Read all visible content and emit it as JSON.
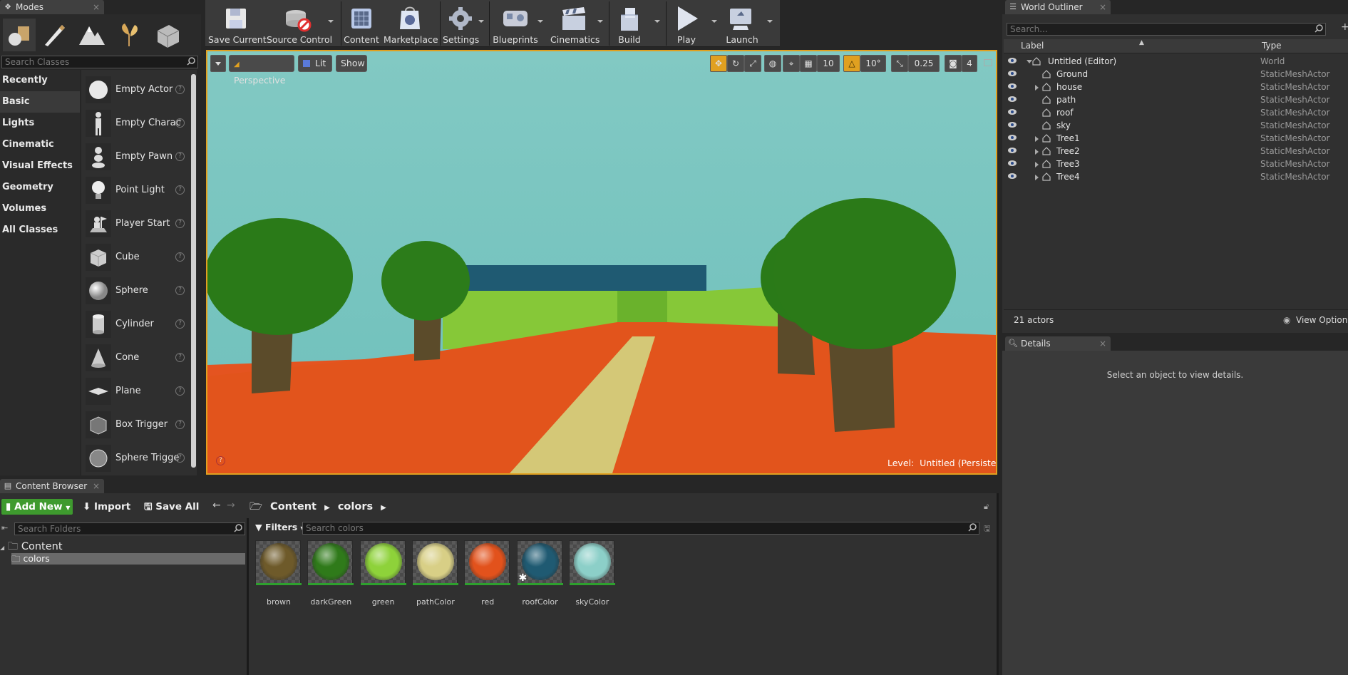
{
  "colors": {
    "accent": "#e0a020",
    "add_green": "#3e9a2e",
    "sky": "#7ec7c2",
    "ground": "#e55a1e",
    "tree_green": "#2b7a18",
    "trunk": "#5a4a28",
    "path": "#d6c97a",
    "roof": "#1e5a72",
    "wall_green": "#8cc838"
  },
  "modes": {
    "tab_title": "Modes",
    "mode_icons": [
      "place-mode-icon",
      "paint-mode-icon",
      "landscape-mode-icon",
      "foliage-mode-icon",
      "geometry-mode-icon"
    ],
    "search_placeholder": "Search Classes",
    "categories": [
      "Recently Placed",
      "Basic",
      "Lights",
      "Cinematic",
      "Visual Effects",
      "Geometry",
      "Volumes",
      "All Classes"
    ],
    "items": [
      "Empty Actor",
      "Empty Charac",
      "Empty Pawn",
      "Point Light",
      "Player Start",
      "Cube",
      "Sphere",
      "Cylinder",
      "Cone",
      "Plane",
      "Box Trigger",
      "Sphere Trigge"
    ]
  },
  "toolbar": {
    "buttons": [
      "Save Current",
      "Source Control",
      "Content",
      "Marketplace",
      "Settings",
      "Blueprints",
      "Cinematics",
      "Build",
      "Play",
      "Launch"
    ]
  },
  "viewport": {
    "perspective": "Perspective",
    "lit": "Lit",
    "show": "Show",
    "grid_snap": "10",
    "rot_snap": "10°",
    "scale_snap": "0.25",
    "camera_speed": "4",
    "level_label": "Level:",
    "level_name": "Untitled (Persistent)"
  },
  "outliner": {
    "tab_title": "World Outliner",
    "search_placeholder": "Search...",
    "col_label": "Label",
    "col_type": "Type",
    "rows": [
      {
        "label": "Untitled (Editor)",
        "type": "World"
      },
      {
        "label": "Ground",
        "type": "StaticMeshActor"
      },
      {
        "label": "house",
        "type": "StaticMeshActor"
      },
      {
        "label": "path",
        "type": "StaticMeshActor"
      },
      {
        "label": "roof",
        "type": "StaticMeshActor"
      },
      {
        "label": "sky",
        "type": "StaticMeshActor"
      },
      {
        "label": "Tree1",
        "type": "StaticMeshActor"
      },
      {
        "label": "Tree2",
        "type": "StaticMeshActor"
      },
      {
        "label": "Tree3",
        "type": "StaticMeshActor"
      },
      {
        "label": "Tree4",
        "type": "StaticMeshActor"
      }
    ],
    "actor_count": "21 actors",
    "view_options": "View Options"
  },
  "details": {
    "tab_title": "Details",
    "empty_message": "Select an object to view details."
  },
  "content_browser": {
    "tab_title": "Content Browser",
    "add_new": "Add New",
    "import": "Import",
    "save_all": "Save All",
    "path": [
      "Content",
      "colors"
    ],
    "folder_search_placeholder": "Search Folders",
    "filters": "Filters",
    "asset_search_placeholder": "Search colors",
    "tree": [
      "Content",
      "colors"
    ],
    "assets": [
      {
        "name": "brown",
        "color": "#6e5a2a"
      },
      {
        "name": "darkGreen",
        "color": "#2f7a1a"
      },
      {
        "name": "green",
        "color": "#8ed23a"
      },
      {
        "name": "pathColor",
        "color": "#d8cf86"
      },
      {
        "name": "red",
        "color": "#e2521c"
      },
      {
        "name": "roofColor",
        "color": "#1f5a72"
      },
      {
        "name": "skyColor",
        "color": "#8ccfc8"
      }
    ]
  }
}
